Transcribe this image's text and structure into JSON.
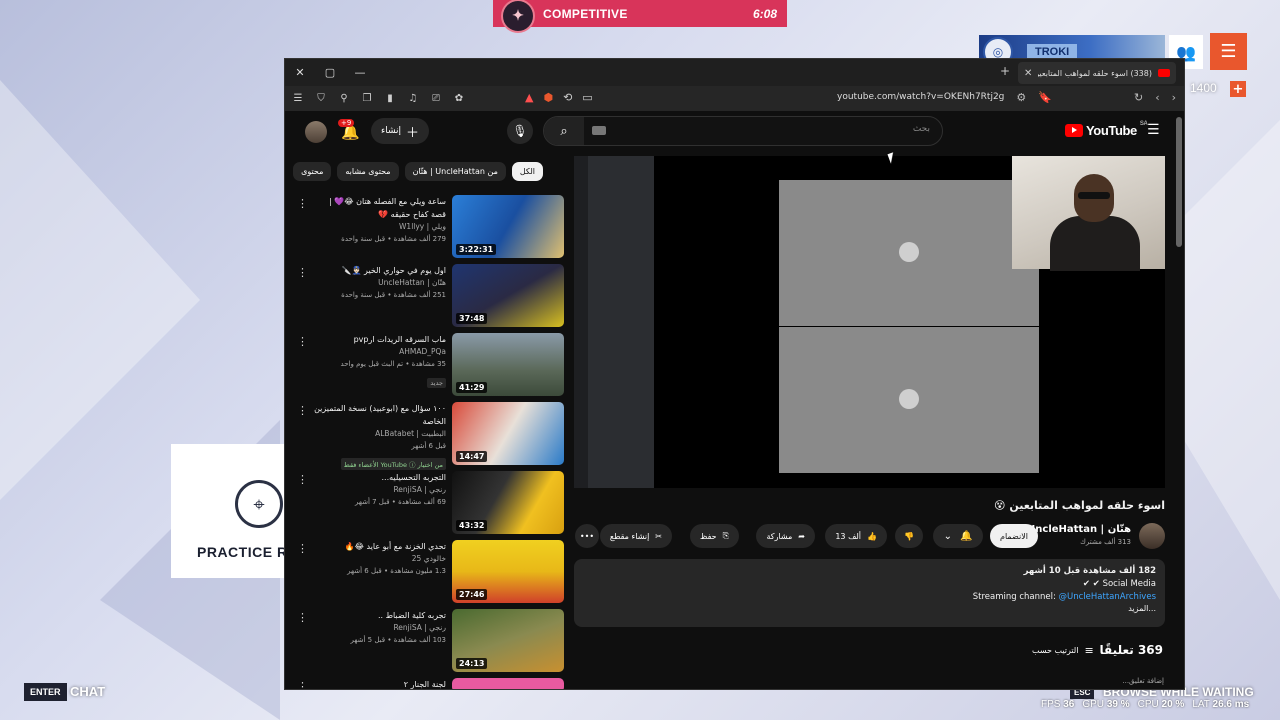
{
  "game": {
    "mode_label": "COMPETITIVE",
    "timer": "6:08",
    "player_tag": "TROKI",
    "currency": "1400",
    "practice_label": "PRACTICE R",
    "chat_key": "ENTER",
    "chat_label": "CHAT",
    "esc_key": "ESC",
    "browse_label": "BROWSE WHILE WAITING",
    "perf": {
      "fps_label": "FPS",
      "fps": "36",
      "gpu_label": "GPU",
      "gpu": "39 %",
      "cpu_label": "CPU",
      "cpu": "20 %",
      "lat_label": "LAT",
      "lat": "26.6 ms"
    },
    "colors": {
      "competitive_bar": "#d8345a",
      "accent_orange": "#e9572d"
    }
  },
  "browser": {
    "tab_title": "(338) اسوء حلقه لمواهب المتابعين",
    "url": "youtube.com/watch?v=OKENh7Rtj2g"
  },
  "youtube": {
    "notif_count": "+9",
    "create_label": "إنشاء",
    "search_placeholder": "بحث",
    "logo_text": "YouTube",
    "region": "SA",
    "chips": [
      "الكل",
      "من UncleHattan | هتّان",
      "محتوى مشابه",
      "محتوى"
    ],
    "recommendations": [
      {
        "title": "ساعة ويلي مع الفصله هتان 😂💜 | قصة كفاح حقيقه 💔",
        "channel": "ويلي | W1llyy",
        "meta": "279 ألف مشاهدة • قبل سنة واحدة",
        "duration": "3:22:31",
        "badge": ""
      },
      {
        "title": "اول يوم في حواري الخير 👮🏻‍♂️🔪",
        "channel": "هتّان | UncleHattan",
        "meta": "251 ألف مشاهدة • قبل سنة واحدة",
        "duration": "37:48",
        "badge": ""
      },
      {
        "title": "ماب السرقه الريدات ارpvp",
        "channel": "AHMAD_PQa",
        "meta": "35 مشاهدة • تم البث قبل يوم واحد",
        "duration": "41:29",
        "badge": "جديد"
      },
      {
        "title": "١٠٠ سؤال مع (ابوعبيد) نسخة المتميزين الخاصة",
        "channel": "البطبيت | ALBatabet",
        "meta": "قبل 6 أشهر",
        "duration": "14:47",
        "badge": "من اختيار YouTube ⓘ الأعضاء فقط"
      },
      {
        "title": "التجربه التحسيليه...",
        "channel": "رنجي | RenjiSA",
        "meta": "69 ألف مشاهدة • قبل 7 أشهر",
        "duration": "43:32",
        "badge": ""
      },
      {
        "title": "تحدي الخزنة مع أبو عايد 😂🔥",
        "channel": "خالودي 25",
        "meta": "1.3 مليون مشاهدة • قبل 6 أشهر",
        "duration": "27:46",
        "badge": ""
      },
      {
        "title": "تجربه كلية الضباط ..",
        "channel": "رنجي | RenjiSA",
        "meta": "103 ألف مشاهدة • قبل 5 أشهر",
        "duration": "24:13",
        "badge": ""
      },
      {
        "title": "لجنة الجنار ٢",
        "channel": "",
        "meta": "",
        "duration": "",
        "badge": ""
      }
    ],
    "video": {
      "title": "اسوء حلقه لمواهب المتابعين 😵",
      "channel_name": "هتّان | UncleHattan",
      "subscribers": "313 ألف مشترك",
      "subscribe_label": "الانضمام",
      "likes": "13 ألف",
      "share_label": "مشاركة",
      "save_label": "حفظ",
      "clip_label": "إنشاء مقطع",
      "views_line": "182 ألف مشاهدة  قبل 10 أشهر",
      "desc_line2": "Social Media ✔ ✔",
      "desc_line3_prefix": "Streaming channel: ",
      "desc_link": "@UncleHattanArchives",
      "more_label": "...المزيد",
      "comments_count": "369 تعليقًا",
      "sort_label": "الترتيب حسب",
      "add_comment_placeholder": "إضافة تعليق..."
    }
  }
}
